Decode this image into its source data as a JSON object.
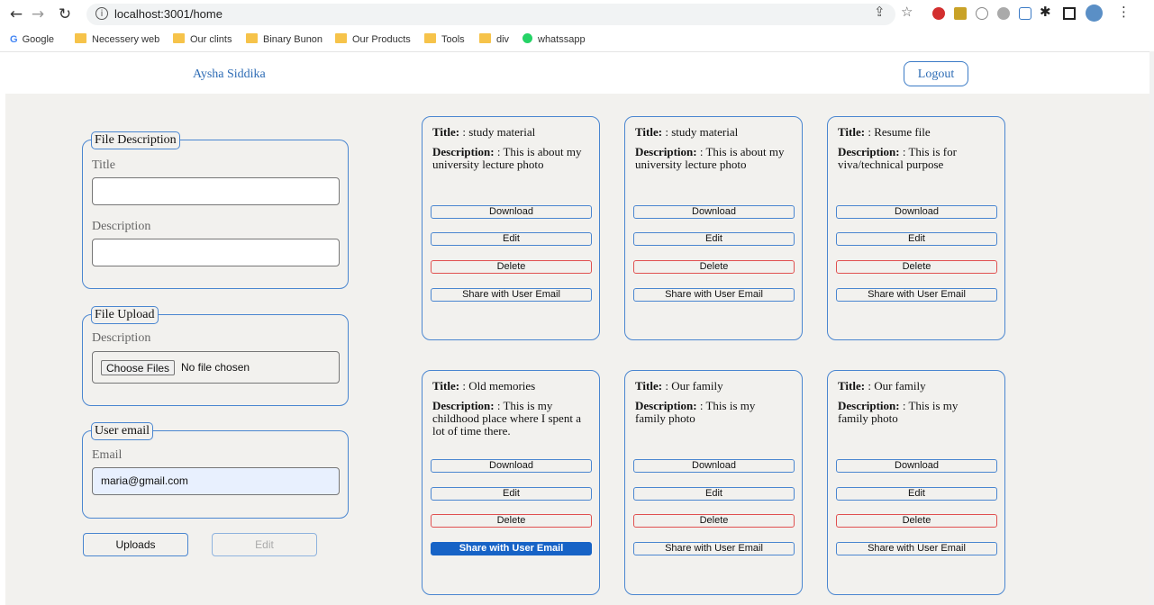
{
  "browser": {
    "url": "localhost:3001/home",
    "bookmarks": [
      "Google",
      "Necessery web",
      "Our clints",
      "Binary Bunon",
      "Our Products",
      "Tools",
      "div",
      "whatssapp"
    ]
  },
  "header": {
    "user_name": "Aysha Siddika",
    "logout_label": "Logout"
  },
  "form": {
    "file_description": {
      "legend": "File Description",
      "title_label": "Title",
      "title_value": "",
      "description_label": "Description",
      "description_value": ""
    },
    "file_upload": {
      "legend": "File Upload",
      "label": "Description",
      "choose_label": "Choose Files",
      "status": "No file chosen"
    },
    "user_email": {
      "legend": "User email",
      "label": "Email",
      "value": "maria@gmail.com"
    },
    "uploads_label": "Uploads",
    "edit_label": "Edit"
  },
  "card_labels": {
    "title": "Title:",
    "description": "Description:",
    "download": "Download",
    "edit": "Edit",
    "delete": "Delete",
    "share": "Share with User Email"
  },
  "cards": [
    {
      "title": ": study material",
      "description": ": This is about my university lecture photo"
    },
    {
      "title": ": study material",
      "description": ": This is about my university lecture photo"
    },
    {
      "title": ": Resume file",
      "description": ": This is for viva/technical purpose"
    },
    {
      "title": ": Old memories",
      "description": ": This is my childhood place where I spent a lot of time there."
    },
    {
      "title": ": Our family",
      "description": ": This is my family photo"
    },
    {
      "title": ": Our family",
      "description": ": This is my family photo"
    }
  ],
  "colors": {
    "accent": "#4a86d0",
    "active_button": "#1763c6",
    "delete_border": "#e05050",
    "background": "#f2f1ee"
  }
}
